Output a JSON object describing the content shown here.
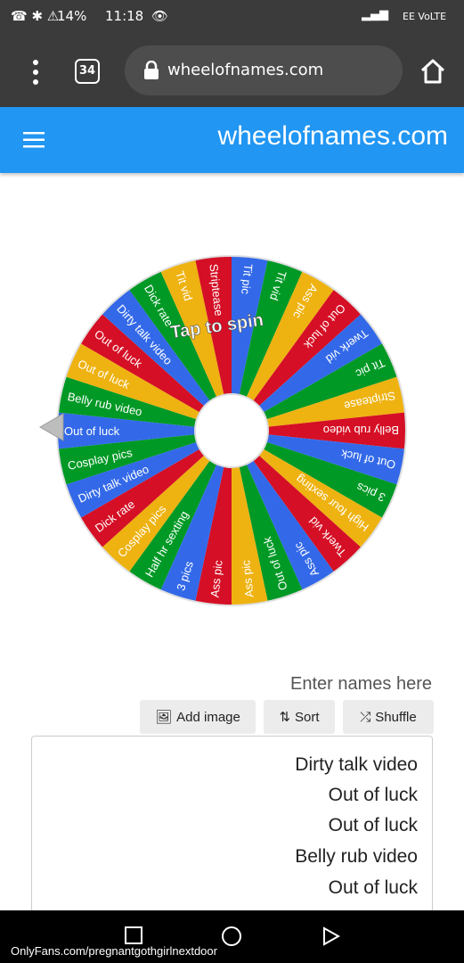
{
  "status_bar": {
    "time": "11:18",
    "battery": "14%",
    "network": "EE VoLTE"
  },
  "browser": {
    "url": "wheelofnames.com",
    "tab_count": "34",
    "icons": [
      "menu-dots-icon",
      "tabs-icon",
      "lock-icon",
      "home-icon"
    ]
  },
  "app": {
    "title": "wheelofnames.com"
  },
  "wheel": {
    "center_text": "Tap to spin",
    "segment_colors": [
      "#3369e8",
      "#009925",
      "#eeb211",
      "#d50f25"
    ],
    "segments": [
      "Out of luck",
      "Belly rub video",
      "Out of luck",
      "Out of luck",
      "Dirty talk video",
      "Dick rate",
      "Tit vid",
      "Striptease",
      "Tit pic",
      "Tit vid",
      "Ass pic",
      "Out of luck",
      "Twerk vid",
      "Tit pic",
      "Striptease",
      "Belly rub video",
      "Out of luck",
      "3 pics",
      "High four sexting",
      "Twerk vid",
      "Ass pic",
      "Out of luck",
      "Ass pic",
      "Ass pic",
      "3 pics",
      "Half hr sexting",
      "Cosplay pics",
      "Dick rate",
      "Dirty talk video",
      "Cosplay pics"
    ]
  },
  "entries": {
    "label": "Enter names here",
    "buttons": {
      "shuffle": "Shuffle",
      "sort": "Sort",
      "add_image": "Add image"
    },
    "lines": [
      "Dirty talk video",
      "Out of luck",
      "Out of luck",
      "Belly rub video",
      "Out of luck"
    ]
  },
  "footer": {
    "url": "OnlyFans.com/pregnantgothgirlnextdoor"
  }
}
